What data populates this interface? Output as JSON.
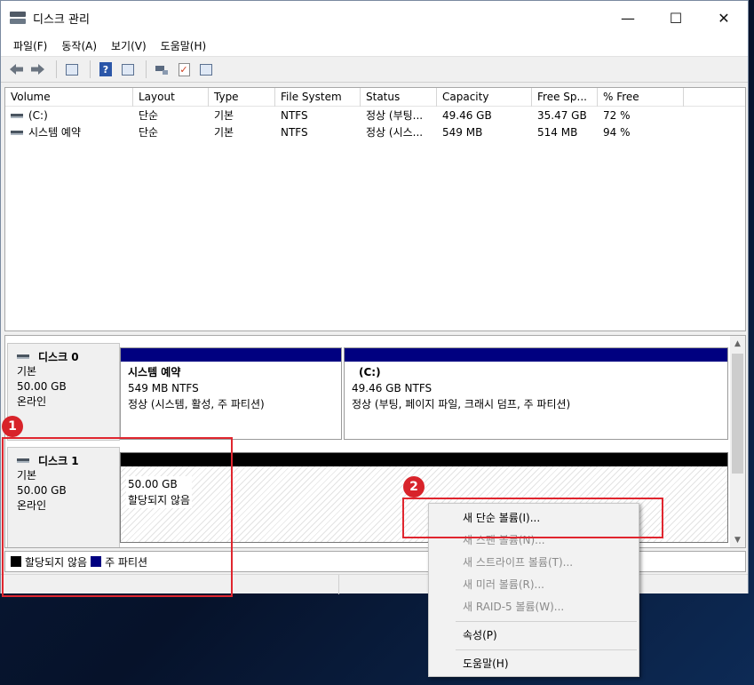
{
  "window": {
    "title": "디스크 관리",
    "controls": {
      "minimize": "—",
      "maximize": "☐",
      "close": "✕"
    }
  },
  "menu": [
    "파일(F)",
    "동작(A)",
    "보기(V)",
    "도움말(H)"
  ],
  "toolbar": {
    "icons": [
      "back-arrow-icon",
      "forward-arrow-icon",
      "console-tree-icon",
      "help-icon",
      "show-pane-icon",
      "connect-icon",
      "check-icon",
      "properties-icon"
    ],
    "help_glyph": "?"
  },
  "volume_list": {
    "columns": [
      "Volume",
      "Layout",
      "Type",
      "File System",
      "Status",
      "Capacity",
      "Free Sp...",
      "% Free"
    ],
    "rows": [
      [
        "(C:)",
        "단순",
        "기본",
        "NTFS",
        "정상 (부팅...",
        "49.46 GB",
        "35.47 GB",
        "72 %"
      ],
      [
        "시스템 예약",
        "단순",
        "기본",
        "NTFS",
        "정상 (시스...",
        "549 MB",
        "514 MB",
        "94 %"
      ]
    ]
  },
  "disks": [
    {
      "name": "디스크 0",
      "type": "기본",
      "size": "50.00 GB",
      "state": "온라인",
      "partitions": [
        {
          "name": "시스템 예약",
          "size_fs": "549 MB NTFS",
          "status": "정상 (시스템, 활성, 주 파티션)"
        },
        {
          "name": "(C:)",
          "size_fs": "49.46 GB NTFS",
          "status": "정상 (부팅, 페이지 파일, 크래시 덤프, 주 파티션)"
        }
      ]
    },
    {
      "name": "디스크 1",
      "type": "기본",
      "size": "50.00 GB",
      "state": "온라인",
      "unallocated": {
        "size": "50.00 GB",
        "label": "할당되지 않음"
      }
    }
  ],
  "legend": [
    {
      "label": "할당되지 않음",
      "color": "#000000"
    },
    {
      "label": "주 파티션",
      "color": "#000080"
    }
  ],
  "context_menu": {
    "items": [
      {
        "label": "새 단순 볼륨(I)...",
        "enabled": true
      },
      {
        "label": "새 스팬 볼륨(N)...",
        "enabled": false
      },
      {
        "label": "새 스트라이프 볼륨(T)...",
        "enabled": false
      },
      {
        "label": "새 미러 볼륨(R)...",
        "enabled": false
      },
      {
        "label": "새 RAID-5 볼륨(W)...",
        "enabled": false
      },
      {
        "label": "속성(P)",
        "enabled": true
      },
      {
        "label": "도움말(H)",
        "enabled": true
      }
    ]
  },
  "annotations": {
    "badge_1": "1",
    "badge_2": "2",
    "highlight_color": "#e0262f"
  },
  "colors": {
    "primary_partition": "#000080",
    "unallocated": "#000000",
    "badge": "#d8232a"
  }
}
